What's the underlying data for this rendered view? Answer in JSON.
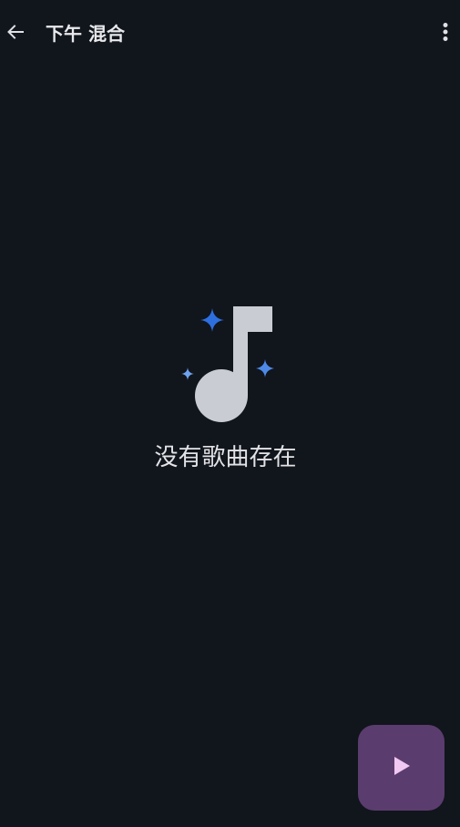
{
  "app": {
    "title": "下午 混合"
  },
  "toolbar": {
    "back_icon": "arrow-left-icon",
    "more_icon": "more-vertical-icon"
  },
  "empty_state": {
    "icon": "music-note-sparkle-icon",
    "message": "没有歌曲存在"
  },
  "fab": {
    "icon": "play-icon"
  },
  "colors": {
    "background": "#11151c",
    "text": "#e2e3e6",
    "note": "#c9ccd3",
    "sparkle_primary": "#2e6fe0",
    "sparkle_secondary": "#6fa3f0",
    "fab_background": "#5b3c6e",
    "fab_icon": "#f0c8f2"
  }
}
